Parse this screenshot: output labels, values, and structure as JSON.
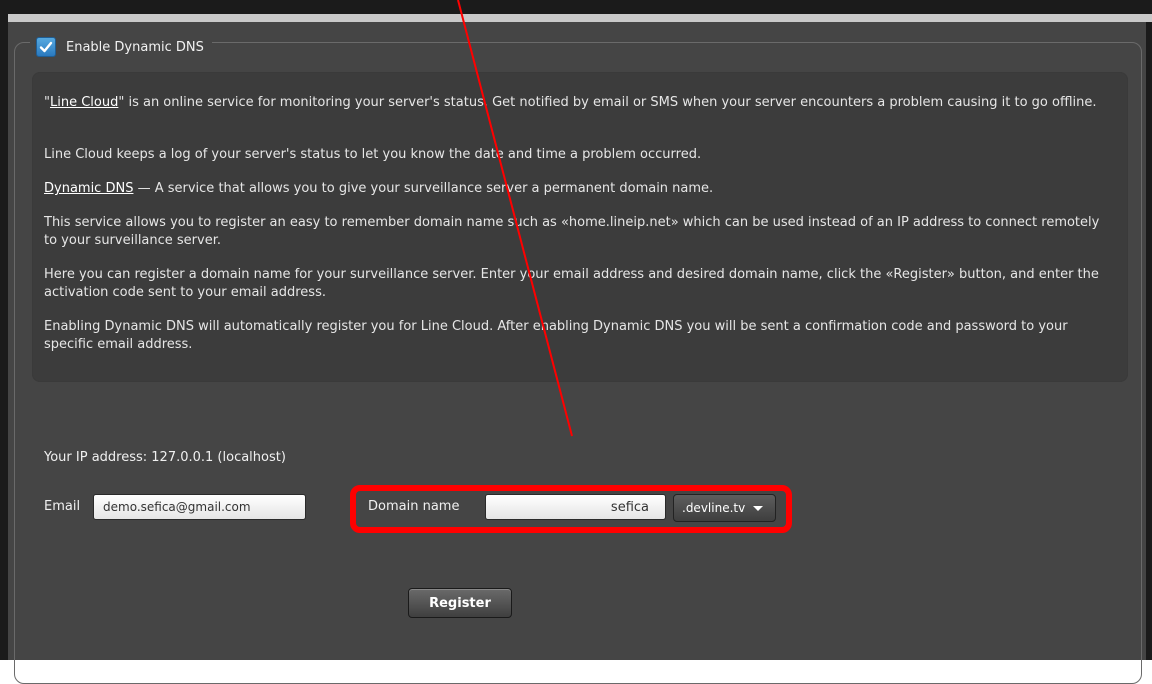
{
  "legend": {
    "label": "Enable Dynamic DNS",
    "checked": true
  },
  "info": {
    "p1_prefix": "\"",
    "p1_link": "Line Cloud",
    "p1_rest": "\" is an online service for monitoring your server's status. Get notified by email or SMS when your server encounters a problem causing it to go offline.",
    "p2": "Line Cloud keeps a log of your server's status to let you know the date and time a problem occurred.",
    "p3_link": "Dynamic DNS",
    "p3_rest": " — A service that allows you to give your surveillance server a permanent domain name.",
    "p4": "This service allows you to register an easy to remember domain name such as «home.lineip.net» which can be used instead of an IP address to connect remotely to your surveillance server.",
    "p5": "Here you can register a domain name for your surveillance server. Enter your email address and desired domain name, click the «Register» button, and enter the activation code sent to your email address.",
    "p6": "Enabling Dynamic DNS will automatically register you for Line Cloud. After enabling Dynamic DNS you will be sent a confirmation code and password to your specific email address."
  },
  "ip_line": "Your IP address: 127.0.0.1 (localhost)",
  "form": {
    "email_label": "Email",
    "email_value": "demo.sefica@gmail.com",
    "domain_label": "Domain name",
    "domain_value": "sefica",
    "tld_selected": ".devline.tv",
    "register_label": "Register"
  },
  "colors": {
    "annotation": "#ff0000",
    "checkbox_accent": "#2a79be",
    "panel_bg": "#454545"
  },
  "icons": {
    "checkbox": "checkmark-icon",
    "dropdown": "chevron-down-icon"
  }
}
